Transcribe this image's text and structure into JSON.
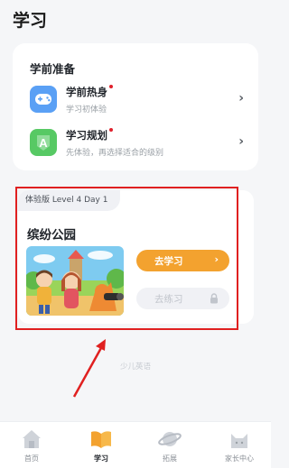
{
  "page": {
    "title": "学习"
  },
  "prep": {
    "title": "学前准备",
    "items": [
      {
        "title": "学前热身",
        "subtitle": "学习初体验",
        "icon": "gamepad-icon",
        "color": "#5aa0f5"
      },
      {
        "title": "学习规划",
        "subtitle": "先体验，再选择适合的级别",
        "icon": "letter-a-icon",
        "color": "#57c964"
      }
    ]
  },
  "lesson": {
    "tag": "体验版 Level 4 Day 1",
    "title": "缤纷公园",
    "go_label": "去学习",
    "go_arrow": "›",
    "practice_label": "去练习"
  },
  "footer": {
    "text": "少儿英语"
  },
  "tabs": [
    {
      "label": "首页",
      "icon": "house-icon",
      "active": false
    },
    {
      "label": "学习",
      "icon": "book-icon",
      "active": true
    },
    {
      "label": "拓展",
      "icon": "planet-icon",
      "active": false
    },
    {
      "label": "家长中心",
      "icon": "cat-ears-icon",
      "active": false
    }
  ],
  "colors": {
    "accent": "#f3a22f",
    "annotation": "#e02020"
  }
}
